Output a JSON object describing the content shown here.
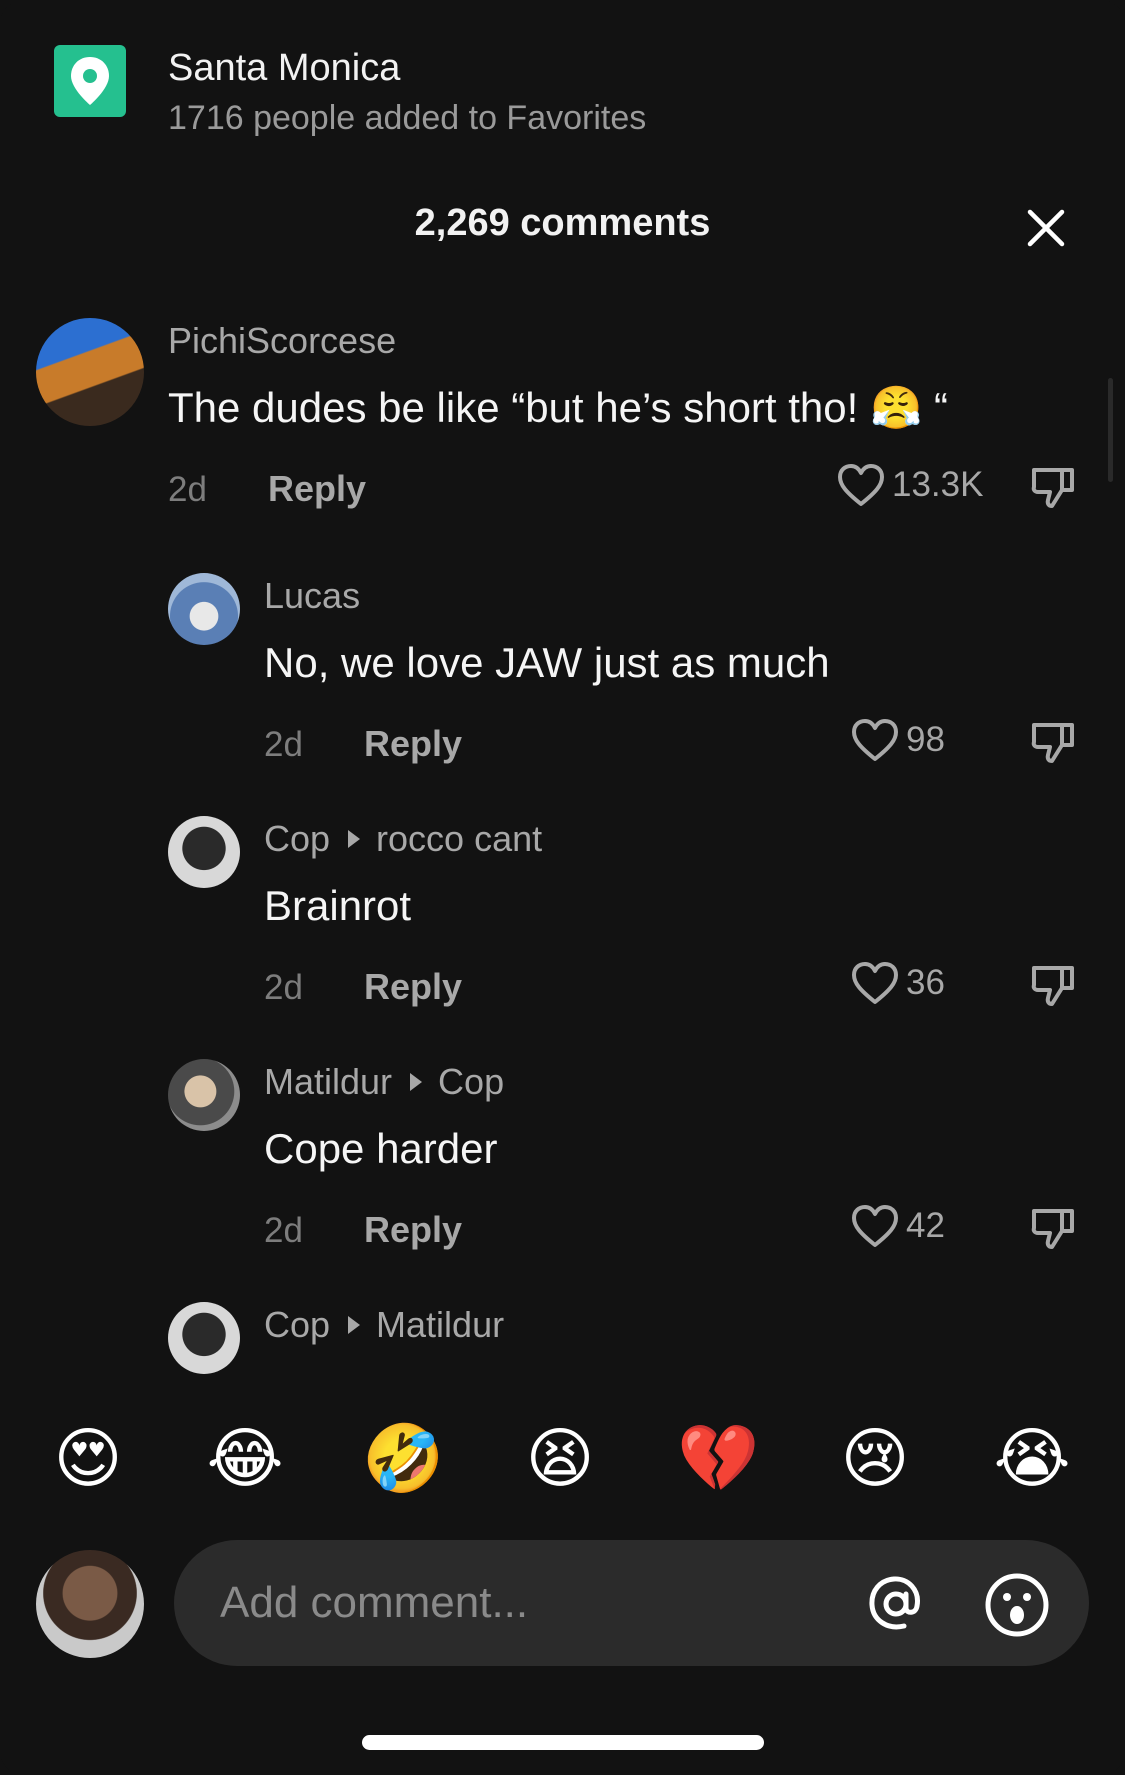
{
  "location": {
    "icon": "location-pin-icon",
    "title": "Santa Monica",
    "subtitle": "1716 people added to Favorites",
    "accent": "#25c08f"
  },
  "header": {
    "title": "2,269 comments",
    "close_icon": "close-icon"
  },
  "comments": [
    {
      "user": "PichiScorcese",
      "reply_to": "",
      "text": "The dudes be like “but he’s short tho! 😤 “",
      "time": "2d",
      "reply_label": "Reply",
      "likes": "13.3K"
    },
    {
      "user": "Lucas",
      "reply_to": "",
      "text": "No, we love JAW just as much",
      "time": "2d",
      "reply_label": "Reply",
      "likes": "98"
    },
    {
      "user": "Cop",
      "reply_to": "rocco cant",
      "text": "Brainrot",
      "time": "2d",
      "reply_label": "Reply",
      "likes": "36"
    },
    {
      "user": "Matildur",
      "reply_to": "Cop",
      "text": "Cope harder",
      "time": "2d",
      "reply_label": "Reply",
      "likes": "42"
    },
    {
      "user": "Cop",
      "reply_to": "Matildur",
      "text": "",
      "time": "",
      "reply_label": "",
      "likes": ""
    }
  ],
  "emoji_bar": [
    "😍",
    "😂",
    "🤣",
    "😫",
    "💔",
    "😢",
    "😭"
  ],
  "input": {
    "placeholder": "Add comment...",
    "at_icon": "at-mention-icon",
    "emoji_icon": "emoji-picker-icon"
  }
}
